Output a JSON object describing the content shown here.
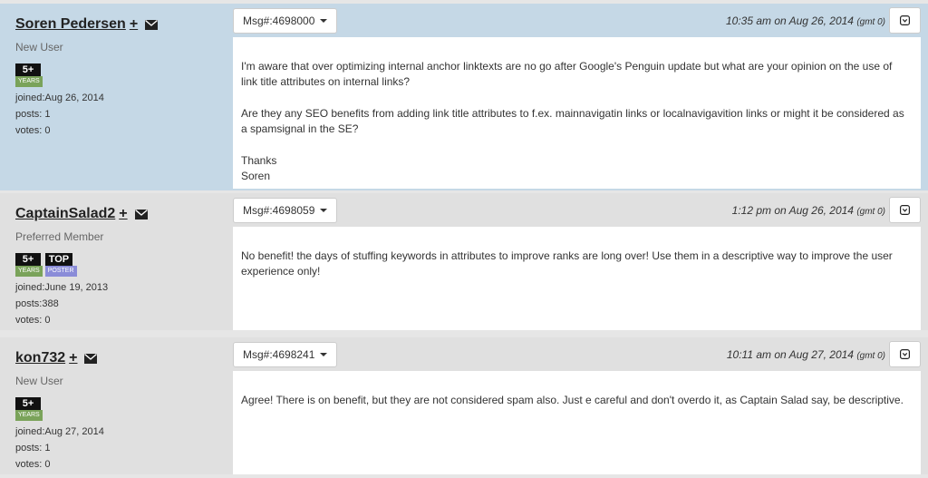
{
  "posts": [
    {
      "username": "Soren Pedersen",
      "plus": "+",
      "role": "New User",
      "badges": [
        {
          "top": "5+",
          "bottom": "YEARS",
          "kind": "years"
        }
      ],
      "joined": "joined:Aug 26, 2014",
      "posts": "posts: 1",
      "votes": "votes: 0",
      "msg_label": "Msg#:4698000",
      "time": "10:35 am on Aug 26, 2014",
      "gmt": "(gmt 0)",
      "paragraphs": [
        "I'm aware that over optimizing internal anchor linktexts are no go after Google's Penguin update but what are your opinion on the use of link title attributes on internal links?",
        "Are they any SEO benefits from adding link title attributes to f.ex. mainnavigatin links or localnavigavition links or might it be considered as a spamsignal in the SE?"
      ],
      "sig_line1": "Thanks",
      "sig_line2": "Soren"
    },
    {
      "username": "CaptainSalad2",
      "plus": "+",
      "role": "Preferred Member",
      "badges": [
        {
          "top": "5+",
          "bottom": "YEARS",
          "kind": "years"
        },
        {
          "top": "TOP",
          "bottom": "POSTER",
          "kind": "poster"
        }
      ],
      "joined": "joined:June 19, 2013",
      "posts": "posts:388",
      "votes": "votes: 0",
      "msg_label": "Msg#:4698059",
      "time": "1:12 pm on Aug 26, 2014",
      "gmt": "(gmt 0)",
      "paragraphs": [
        "No benefit! the days of stuffing keywords in attributes to improve ranks are long over! Use them in a descriptive way to improve the user experience only!"
      ]
    },
    {
      "username": "kon732",
      "plus": "+",
      "role": "New User",
      "badges": [
        {
          "top": "5+",
          "bottom": "YEARS",
          "kind": "years"
        }
      ],
      "joined": "joined:Aug 27, 2014",
      "posts": "posts: 1",
      "votes": "votes: 0",
      "msg_label": "Msg#:4698241",
      "time": "10:11 am on Aug 27, 2014",
      "gmt": "(gmt 0)",
      "paragraphs": [
        "Agree! There is on benefit, but they are not considered spam also. Just e careful and don't overdo it, as Captain Salad say, be descriptive."
      ]
    }
  ],
  "icons": {
    "mail": "envelope-icon",
    "options": "chevron-down-box-icon"
  },
  "colors": {
    "first_post_bg": "#c5d8e6",
    "post_bg": "#e0e0e0",
    "years_badge": "#7aa35a",
    "poster_badge": "#8a8cd8"
  }
}
